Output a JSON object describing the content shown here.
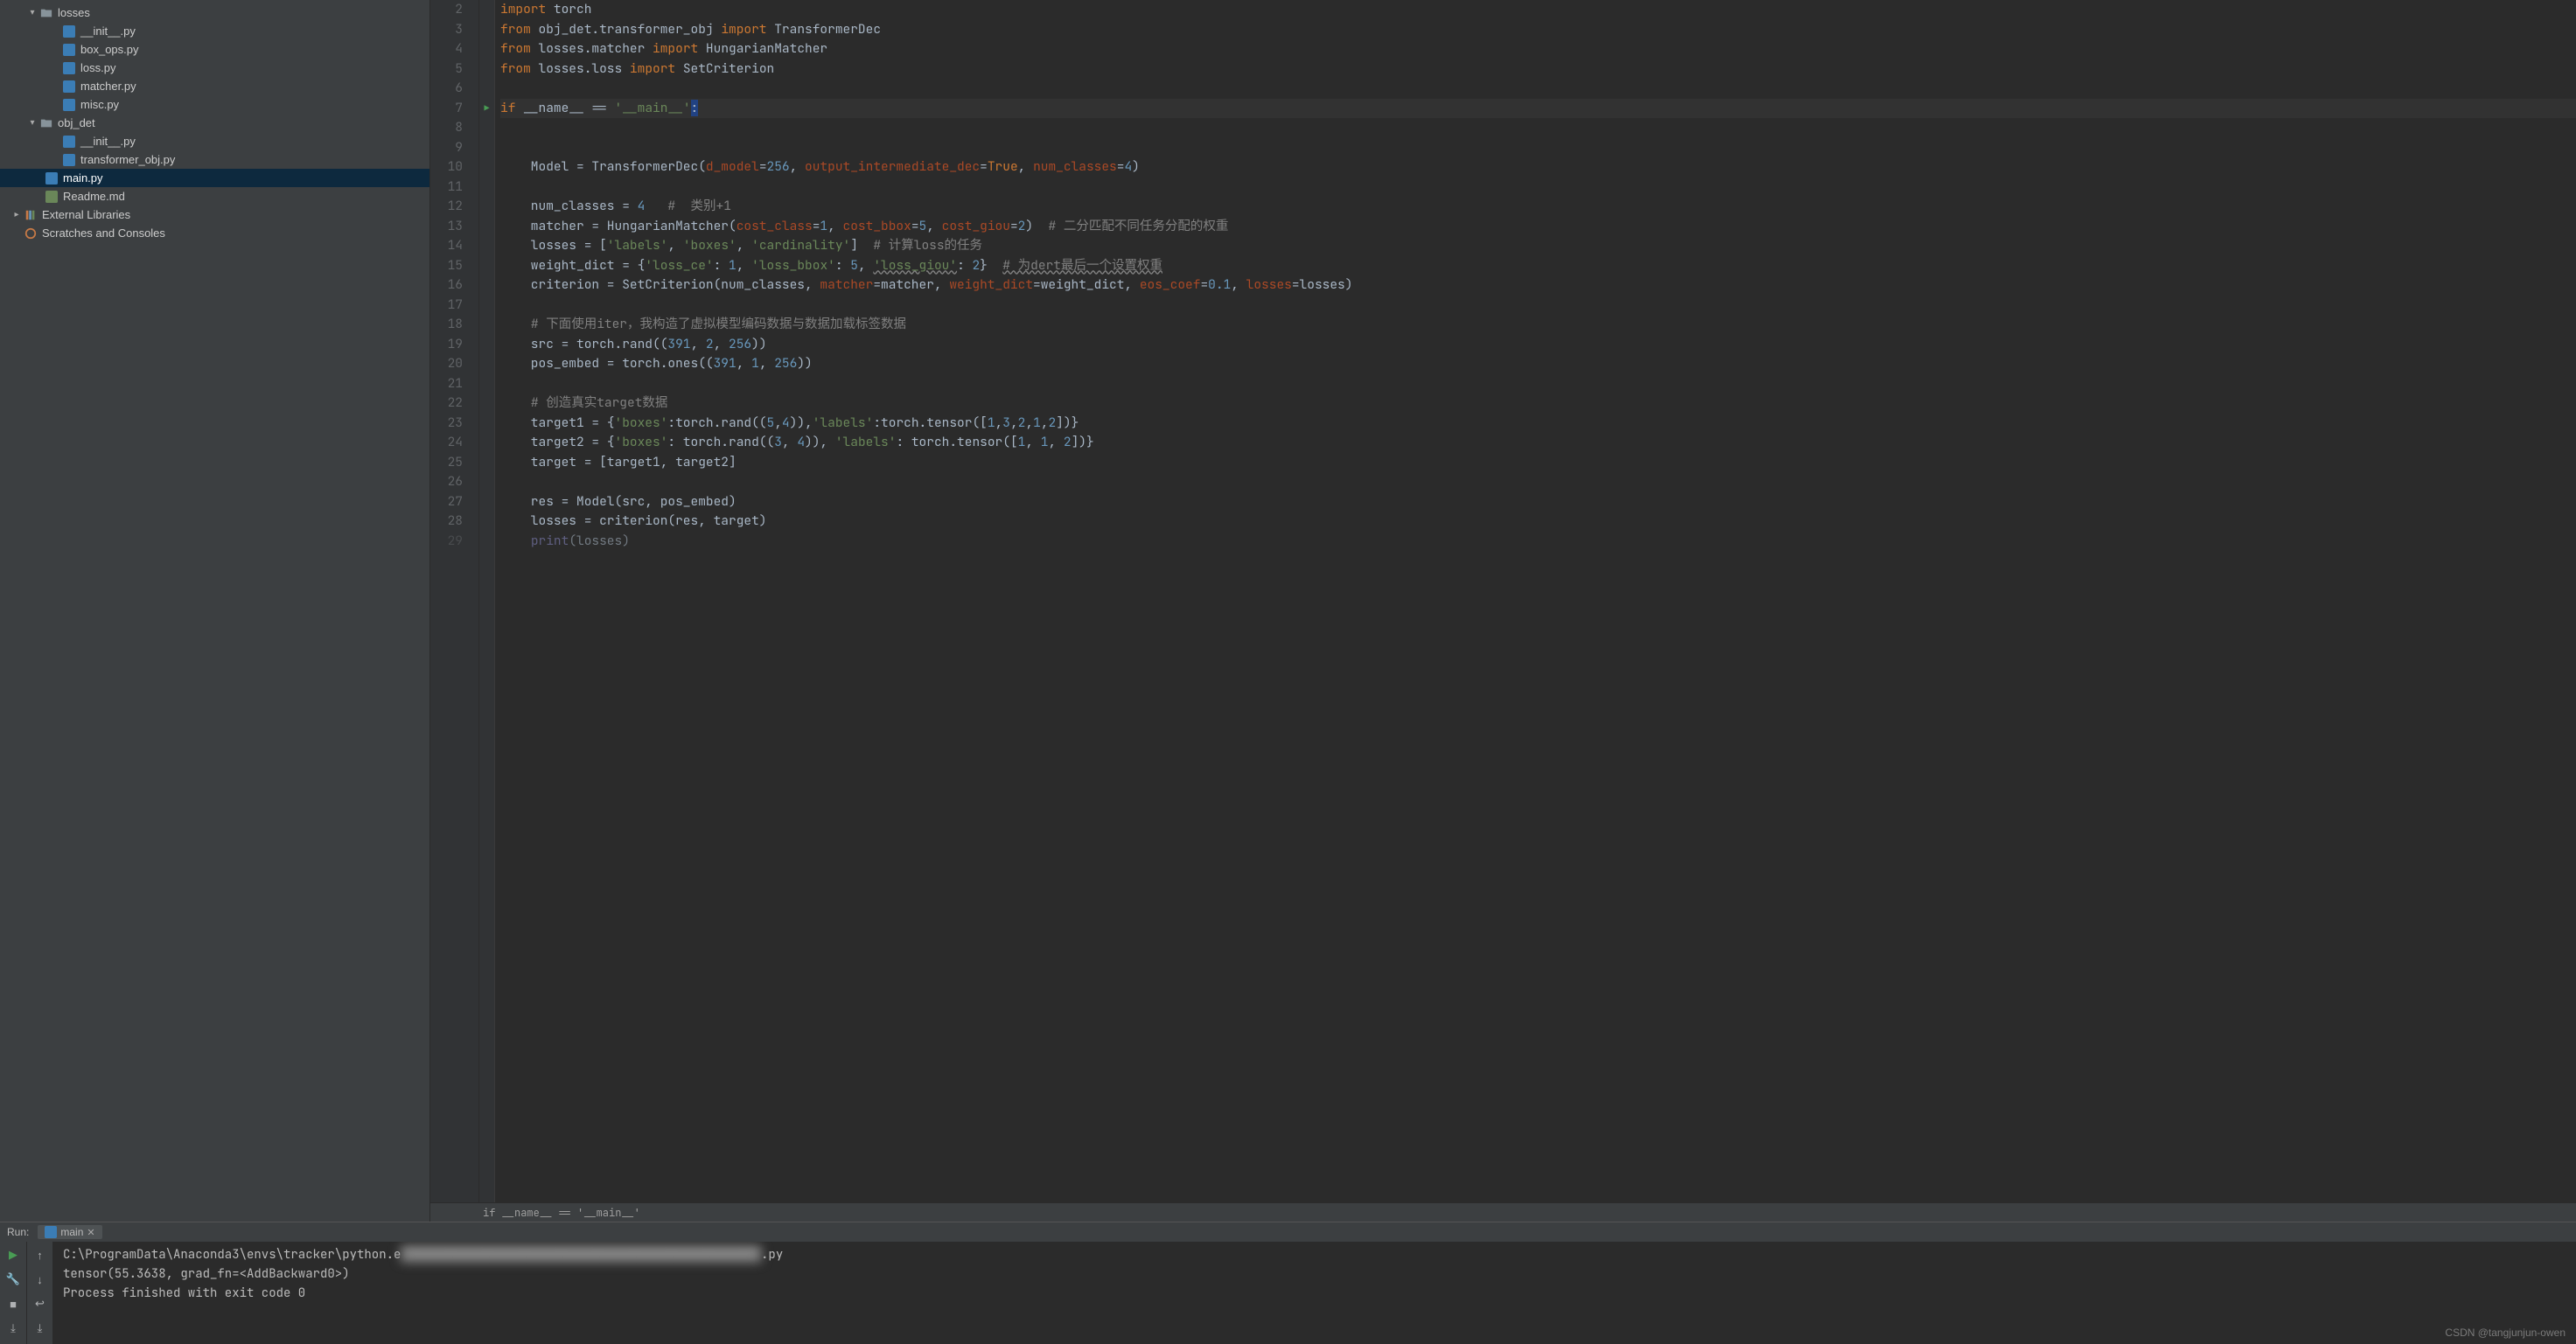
{
  "tree": {
    "losses": {
      "label": "losses",
      "expanded": true,
      "children": [
        {
          "label": "__init__.py",
          "kind": "py"
        },
        {
          "label": "box_ops.py",
          "kind": "py"
        },
        {
          "label": "loss.py",
          "kind": "py"
        },
        {
          "label": "matcher.py",
          "kind": "py"
        },
        {
          "label": "misc.py",
          "kind": "py"
        }
      ]
    },
    "obj_det": {
      "label": "obj_det",
      "expanded": true,
      "children": [
        {
          "label": "__init__.py",
          "kind": "py"
        },
        {
          "label": "transformer_obj.py",
          "kind": "py"
        }
      ]
    },
    "main": {
      "label": "main.py",
      "kind": "py",
      "selected": true
    },
    "readme": {
      "label": "Readme.md",
      "kind": "md"
    },
    "ext": {
      "label": "External Libraries"
    },
    "scratch": {
      "label": "Scratches and Consoles"
    }
  },
  "code": {
    "lines": [
      {
        "n": 2,
        "tokens": [
          [
            "kw",
            "import"
          ],
          [
            "op",
            " torch"
          ]
        ]
      },
      {
        "n": 3,
        "tokens": [
          [
            "kw",
            "from"
          ],
          [
            "op",
            " obj_det.transformer_obj "
          ],
          [
            "kw",
            "import"
          ],
          [
            "op",
            " TransformerDec"
          ]
        ]
      },
      {
        "n": 4,
        "tokens": [
          [
            "kw",
            "from"
          ],
          [
            "op",
            " losses.matcher "
          ],
          [
            "kw",
            "import"
          ],
          [
            "op",
            " HungarianMatcher"
          ]
        ]
      },
      {
        "n": 5,
        "tokens": [
          [
            "kw",
            "from"
          ],
          [
            "op",
            " losses.loss "
          ],
          [
            "kw",
            "import"
          ],
          [
            "op",
            " SetCriterion"
          ]
        ]
      },
      {
        "n": 6,
        "tokens": []
      },
      {
        "n": 7,
        "run": true,
        "hl": true,
        "tokens": [
          [
            "kw",
            "if"
          ],
          [
            "op",
            " __name__ == "
          ],
          [
            "str",
            "'__main__'"
          ],
          [
            "sel",
            ":"
          ]
        ]
      },
      {
        "n": 8,
        "tokens": []
      },
      {
        "n": 9,
        "tokens": []
      },
      {
        "n": 10,
        "tokens": [
          [
            "op",
            "    Model = TransformerDec("
          ],
          [
            "param",
            "d_model"
          ],
          [
            "op",
            "="
          ],
          [
            "num",
            "256"
          ],
          [
            "op",
            ", "
          ],
          [
            "param",
            "output_intermediate_dec"
          ],
          [
            "op",
            "="
          ],
          [
            "kw",
            "True"
          ],
          [
            "op",
            ", "
          ],
          [
            "param",
            "num_classes"
          ],
          [
            "op",
            "="
          ],
          [
            "num",
            "4"
          ],
          [
            "op",
            ")"
          ]
        ]
      },
      {
        "n": 11,
        "tokens": []
      },
      {
        "n": 12,
        "tokens": [
          [
            "op",
            "    num_classes = "
          ],
          [
            "num",
            "4"
          ],
          [
            "op",
            "   "
          ],
          [
            "cmt",
            "#  类别+1"
          ]
        ]
      },
      {
        "n": 13,
        "tokens": [
          [
            "op",
            "    matcher = HungarianMatcher("
          ],
          [
            "param",
            "cost_class"
          ],
          [
            "op",
            "="
          ],
          [
            "num",
            "1"
          ],
          [
            "op",
            ", "
          ],
          [
            "param",
            "cost_bbox"
          ],
          [
            "op",
            "="
          ],
          [
            "num",
            "5"
          ],
          [
            "op",
            ", "
          ],
          [
            "param",
            "cost_giou"
          ],
          [
            "op",
            "="
          ],
          [
            "num",
            "2"
          ],
          [
            "op",
            ")  "
          ],
          [
            "cmt",
            "# 二分匹配不同任务分配的权重"
          ]
        ]
      },
      {
        "n": 14,
        "tokens": [
          [
            "op",
            "    losses = ["
          ],
          [
            "str",
            "'labels'"
          ],
          [
            "op",
            ", "
          ],
          [
            "str",
            "'boxes'"
          ],
          [
            "op",
            ", "
          ],
          [
            "str",
            "'cardinality'"
          ],
          [
            "op",
            "]  "
          ],
          [
            "cmt",
            "# 计算loss的任务"
          ]
        ]
      },
      {
        "n": 15,
        "tokens": [
          [
            "op",
            "    weight_dict = {"
          ],
          [
            "str",
            "'loss_ce'"
          ],
          [
            "op",
            ": "
          ],
          [
            "num",
            "1"
          ],
          [
            "op",
            ", "
          ],
          [
            "str",
            "'loss_bbox'"
          ],
          [
            "op",
            ": "
          ],
          [
            "num",
            "5"
          ],
          [
            "op",
            ", "
          ],
          [
            "str",
            "'loss_giou'",
            "u"
          ],
          [
            "op",
            ": "
          ],
          [
            "num",
            "2"
          ],
          [
            "op",
            "}  "
          ],
          [
            "cmt",
            "# 为dert最后一个设置权重",
            "u"
          ]
        ]
      },
      {
        "n": 16,
        "tokens": [
          [
            "op",
            "    criterion = SetCriterion(num_classes, "
          ],
          [
            "param",
            "matcher"
          ],
          [
            "op",
            "=matcher, "
          ],
          [
            "param",
            "weight_dict"
          ],
          [
            "op",
            "=weight_dict, "
          ],
          [
            "param",
            "eos_coef"
          ],
          [
            "op",
            "="
          ],
          [
            "num",
            "0.1"
          ],
          [
            "op",
            ", "
          ],
          [
            "param",
            "losses"
          ],
          [
            "op",
            "=losses)"
          ]
        ]
      },
      {
        "n": 17,
        "tokens": []
      },
      {
        "n": 18,
        "tokens": [
          [
            "op",
            "    "
          ],
          [
            "cmt",
            "# 下面使用iter，我构造了虚拟模型编码数据与数据加载标签数据"
          ]
        ]
      },
      {
        "n": 19,
        "tokens": [
          [
            "op",
            "    src = torch.rand(("
          ],
          [
            "num",
            "391"
          ],
          [
            "op",
            ", "
          ],
          [
            "num",
            "2"
          ],
          [
            "op",
            ", "
          ],
          [
            "num",
            "256"
          ],
          [
            "op",
            "))"
          ]
        ]
      },
      {
        "n": 20,
        "tokens": [
          [
            "op",
            "    pos_embed = torch.ones(("
          ],
          [
            "num",
            "391"
          ],
          [
            "op",
            ", "
          ],
          [
            "num",
            "1"
          ],
          [
            "op",
            ", "
          ],
          [
            "num",
            "256"
          ],
          [
            "op",
            "))"
          ]
        ]
      },
      {
        "n": 21,
        "tokens": []
      },
      {
        "n": 22,
        "tokens": [
          [
            "op",
            "    "
          ],
          [
            "cmt",
            "# 创造真实target数据"
          ]
        ]
      },
      {
        "n": 23,
        "tokens": [
          [
            "op",
            "    target1 = {"
          ],
          [
            "str",
            "'boxes'"
          ],
          [
            "op",
            ":torch.rand(("
          ],
          [
            "num",
            "5"
          ],
          [
            "op",
            ","
          ],
          [
            "num",
            "4"
          ],
          [
            "op",
            ")),"
          ],
          [
            "str",
            "'labels'"
          ],
          [
            "op",
            ":torch.tensor(["
          ],
          [
            "num",
            "1"
          ],
          [
            "op",
            ","
          ],
          [
            "num",
            "3"
          ],
          [
            "op",
            ","
          ],
          [
            "num",
            "2"
          ],
          [
            "op",
            ","
          ],
          [
            "num",
            "1"
          ],
          [
            "op",
            ","
          ],
          [
            "num",
            "2"
          ],
          [
            "op",
            "])}"
          ]
        ]
      },
      {
        "n": 24,
        "tokens": [
          [
            "op",
            "    target2 = {"
          ],
          [
            "str",
            "'boxes'"
          ],
          [
            "op",
            ": torch.rand(("
          ],
          [
            "num",
            "3"
          ],
          [
            "op",
            ", "
          ],
          [
            "num",
            "4"
          ],
          [
            "op",
            ")), "
          ],
          [
            "str",
            "'labels'"
          ],
          [
            "op",
            ": torch.tensor(["
          ],
          [
            "num",
            "1"
          ],
          [
            "op",
            ", "
          ],
          [
            "num",
            "1"
          ],
          [
            "op",
            ", "
          ],
          [
            "num",
            "2"
          ],
          [
            "op",
            "])}"
          ]
        ]
      },
      {
        "n": 25,
        "tokens": [
          [
            "op",
            "    target = [target1, target2]"
          ]
        ]
      },
      {
        "n": 26,
        "tokens": []
      },
      {
        "n": 27,
        "tokens": [
          [
            "op",
            "    res = Model(src, pos_embed)"
          ]
        ]
      },
      {
        "n": 28,
        "tokens": [
          [
            "op",
            "    losses = criterion(res, target)"
          ]
        ]
      },
      {
        "n": 29,
        "dim": true,
        "tokens": [
          [
            "op",
            "    "
          ],
          [
            "builtin",
            "print"
          ],
          [
            "op",
            "(losses)"
          ]
        ]
      }
    ]
  },
  "breadcrumb": "if __name__ == '__main__'",
  "run": {
    "label": "Run:",
    "tab": "main",
    "console": [
      {
        "pre": "C:\\ProgramData\\Anaconda3\\envs\\tracker\\python.e",
        "blur": "█████████████████████████████████████████████████",
        "post": ".py"
      },
      {
        "text": "tensor(55.3638, grad_fn=<AddBackward0>)"
      },
      {
        "text": ""
      },
      {
        "text": "Process finished with exit code 0"
      }
    ]
  },
  "watermark": "CSDN @tangjunjun-owen"
}
